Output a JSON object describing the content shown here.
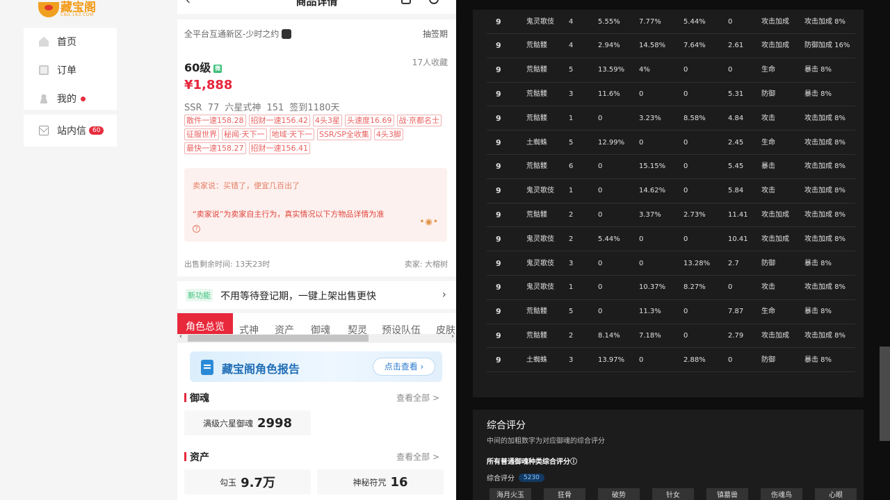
{
  "logo": {
    "text": "藏宝阁",
    "sub": "CBG.163.COM"
  },
  "nav": {
    "items": [
      {
        "label": "首页"
      },
      {
        "label": "订单"
      },
      {
        "label": "我的"
      },
      {
        "label": "站内信",
        "badge": "60"
      }
    ]
  },
  "phone": {
    "header": {
      "title": "商品详情"
    },
    "server": "全平台互通新区-少时之约",
    "draw": "抽签期",
    "level": "60级",
    "level_tag": "微",
    "favorites": "17人收藏",
    "price": "¥1,888",
    "summary": "SSR 77  六星式神 151  签到1180天",
    "tags": [
      "散件一速158.28",
      "招财一速156.42",
      "4头3星",
      "头速度16.69",
      "战·京都名士",
      "征服世界",
      "秘闻·天下一",
      "地域·天下一",
      "SSR/SP全收集",
      "4头3脚",
      "最快一速158.27",
      "招财一速156.41"
    ],
    "seller_say": "卖家说：买错了，便宜几百出了",
    "seller_note": "“卖家说”为卖家自主行为，真实情况以下方物品详情为准",
    "seller_dots": "•◉•",
    "remaining": "出售剩余时间: 13天23时",
    "seller": "卖家: 大榕树",
    "banner": {
      "tag": "新功能",
      "text": "不用等待登记期，一键上架出售更快"
    },
    "tabs": [
      "角色总览",
      "式神",
      "资产",
      "御魂",
      "契灵",
      "预设队伍",
      "皮肤"
    ],
    "report": {
      "title": "藏宝阁角色报告",
      "button": "点击查看 ›"
    },
    "yuhun": {
      "title": "御魂",
      "view_all": "查看全部 >",
      "stat_label": "满级六星御魂",
      "stat_value": "2998"
    },
    "assets": {
      "title": "资产",
      "view_all": "查看全部 >",
      "items": [
        {
          "label": "勾玉",
          "value": "9.7万"
        },
        {
          "label": "神秘符咒",
          "value": "16"
        }
      ]
    }
  },
  "table": {
    "rows": [
      [
        "9",
        "鬼灵歌伎",
        "4",
        "5.55%",
        "7.77%",
        "5.44%",
        "0",
        "攻击加成",
        "攻击加成 8%"
      ],
      [
        "9",
        "荒骷髅",
        "4",
        "2.94%",
        "14.58%",
        "7.64%",
        "2.61",
        "攻击加成",
        "防御加成 16%"
      ],
      [
        "9",
        "荒骷髅",
        "5",
        "13.59%",
        "4%",
        "0",
        "0",
        "生命",
        "暴击 8%"
      ],
      [
        "9",
        "荒骷髅",
        "3",
        "11.6%",
        "0",
        "0",
        "5.31",
        "防御",
        "暴击 8%"
      ],
      [
        "9",
        "荒骷髅",
        "1",
        "0",
        "3.23%",
        "8.58%",
        "4.84",
        "攻击",
        "攻击加成 8%"
      ],
      [
        "9",
        "土蜘蛛",
        "5",
        "12.99%",
        "0",
        "0",
        "2.45",
        "生命",
        "攻击加成 8%"
      ],
      [
        "9",
        "荒骷髅",
        "6",
        "0",
        "15.15%",
        "0",
        "5.45",
        "暴击",
        "攻击加成 8%"
      ],
      [
        "9",
        "鬼灵歌伎",
        "1",
        "0",
        "14.62%",
        "0",
        "5.84",
        "攻击",
        "攻击加成 8%"
      ],
      [
        "9",
        "荒骷髅",
        "2",
        "0",
        "3.37%",
        "2.73%",
        "11.41",
        "攻击加成",
        "攻击加成 8%"
      ],
      [
        "9",
        "鬼灵歌伎",
        "2",
        "5.44%",
        "0",
        "0",
        "10.41",
        "攻击加成",
        "攻击加成 8%"
      ],
      [
        "9",
        "鬼灵歌伎",
        "3",
        "0",
        "0",
        "13.28%",
        "2.7",
        "防御",
        "暴击 8%"
      ],
      [
        "9",
        "鬼灵歌伎",
        "1",
        "0",
        "10.37%",
        "8.27%",
        "0",
        "攻击",
        "攻击加成 8%"
      ],
      [
        "9",
        "荒骷髅",
        "5",
        "0",
        "11.3%",
        "0",
        "7.87",
        "生命",
        "暴击 8%"
      ],
      [
        "9",
        "荒骷髅",
        "2",
        "8.14%",
        "7.18%",
        "0",
        "2.79",
        "攻击加成",
        "攻击加成 8%"
      ],
      [
        "9",
        "土蜘蛛",
        "3",
        "13.97%",
        "0",
        "2.88%",
        "0",
        "防御",
        "暴击 8%"
      ]
    ]
  },
  "score": {
    "title": "综合评分",
    "subtitle": "中间的加粗数字为对应御魂的综合评分",
    "all_label": "所有普通御魂种类综合评分ⓘ",
    "line_label": "综合评分",
    "line_value": "5230",
    "chips": [
      "海月火玉",
      "狂骨",
      "破势",
      "针女",
      "镇墓兽",
      "伤魂鸟",
      "心眼"
    ]
  },
  "colors": {
    "brand_red": "#e8283b",
    "price_red": "#e6253b",
    "dark_bg": "#0e0e0e",
    "panel_bg": "#1c1c1c"
  }
}
